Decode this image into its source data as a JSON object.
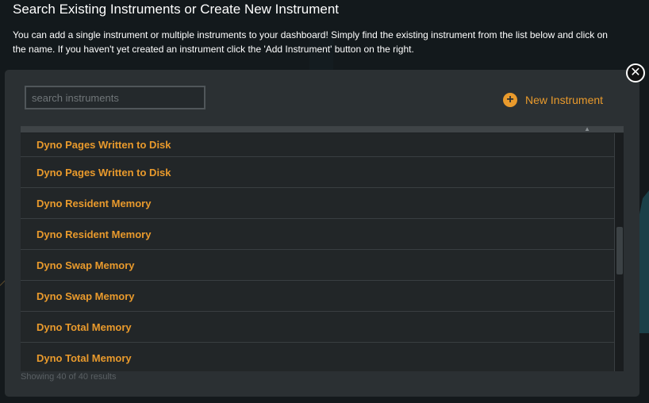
{
  "header": {
    "title": "Search Existing Instruments or Create New Instrument",
    "description": "You can add a single instrument or multiple instruments to your dashboard! Simply find the existing instrument from the list below and click on the name. If you haven't yet created an instrument click the 'Add Instrument' button on the right."
  },
  "search": {
    "placeholder": "search instruments",
    "value": ""
  },
  "new_instrument": {
    "label": "New Instrument",
    "icon": "plus-circle-icon"
  },
  "close": {
    "icon": "close-icon",
    "glyph": "✕"
  },
  "instruments": [
    "Dyno Pages Written to Disk",
    "Dyno Pages Written to Disk",
    "Dyno Resident Memory",
    "Dyno Resident Memory",
    "Dyno Swap Memory",
    "Dyno Swap Memory",
    "Dyno Total Memory",
    "Dyno Total Memory"
  ],
  "status": "Showing 40 of 40 results",
  "colors": {
    "accent": "#e99a2c",
    "modal_bg": "#2b3033",
    "row_bg": "#222628"
  }
}
